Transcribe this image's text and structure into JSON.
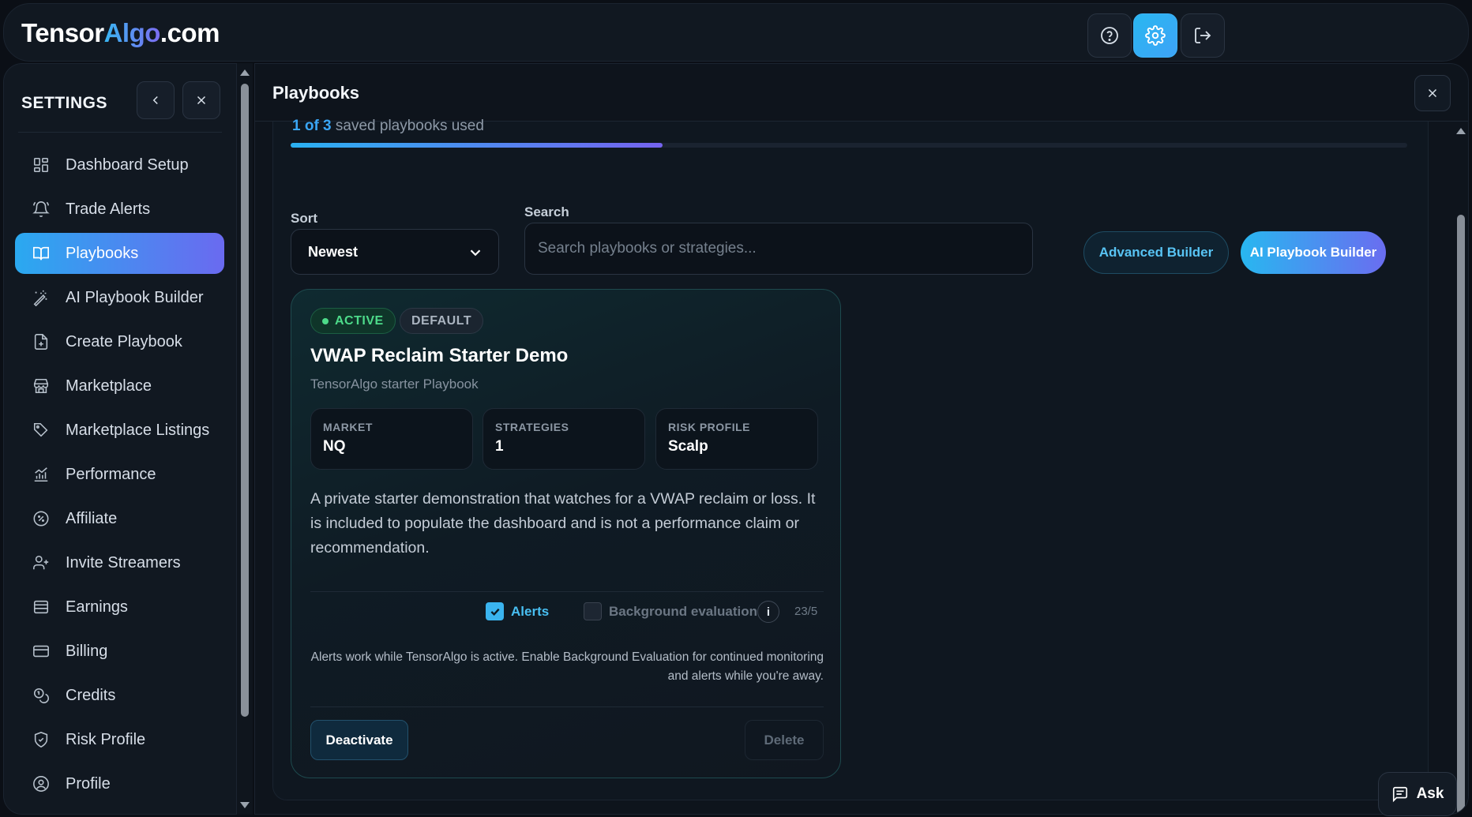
{
  "brand": {
    "prefix": "Tensor",
    "accent": "Algo",
    "suffix": ".com"
  },
  "topbar": {
    "help_icon": "help-circle-icon",
    "settings_icon": "gear-icon",
    "logout_icon": "logout-icon"
  },
  "sidebar": {
    "title": "SETTINGS",
    "items": [
      {
        "label": "Dashboard Setup",
        "icon": "dashboard-icon"
      },
      {
        "label": "Trade Alerts",
        "icon": "bell-icon"
      },
      {
        "label": "Playbooks",
        "icon": "book-icon",
        "active": true
      },
      {
        "label": "AI Playbook Builder",
        "icon": "magic-wand-icon"
      },
      {
        "label": "Create Playbook",
        "icon": "file-plus-icon"
      },
      {
        "label": "Marketplace",
        "icon": "store-icon"
      },
      {
        "label": "Marketplace Listings",
        "icon": "tags-icon"
      },
      {
        "label": "Performance",
        "icon": "chart-icon"
      },
      {
        "label": "Affiliate",
        "icon": "badge-percent-icon"
      },
      {
        "label": "Invite Streamers",
        "icon": "user-plus-icon"
      },
      {
        "label": "Earnings",
        "icon": "wallet-icon"
      },
      {
        "label": "Billing",
        "icon": "credit-card-icon"
      },
      {
        "label": "Credits",
        "icon": "coins-icon"
      },
      {
        "label": "Risk Profile",
        "icon": "shield-icon"
      },
      {
        "label": "Profile",
        "icon": "user-circle-icon"
      }
    ]
  },
  "main": {
    "title": "Playbooks",
    "usage": {
      "count_text": "1 of 3",
      "rest_text": " saved playbooks used",
      "fraction": 0.333
    },
    "sort": {
      "label": "Sort",
      "value": "Newest"
    },
    "search": {
      "label": "Search",
      "placeholder": "Search playbooks or strategies..."
    },
    "buttons": {
      "advanced": "Advanced Builder",
      "ai": "AI Playbook Builder"
    },
    "card": {
      "badge_active": "ACTIVE",
      "badge_default": "DEFAULT",
      "title": "VWAP Reclaim Starter Demo",
      "subtitle": "TensorAlgo starter Playbook",
      "stats": [
        {
          "key": "MARKET",
          "value": "NQ"
        },
        {
          "key": "STRATEGIES",
          "value": "1"
        },
        {
          "key": "RISK PROFILE",
          "value": "Scalp"
        }
      ],
      "description": "A private starter demonstration that watches for a VWAP reclaim or loss. It is included to populate the dashboard and is not a performance claim or recommendation.",
      "alerts_label": "Alerts",
      "background_label": "Background evaluation",
      "info_glyph": "i",
      "count": "23/5",
      "note": "Alerts work while TensorAlgo is active. Enable Background Evaluation for continued monitoring and alerts while you're away.",
      "deactivate": "Deactivate",
      "delete": "Delete"
    }
  },
  "ask": {
    "label": "Ask"
  },
  "colors": {
    "accent_blue": "#2ab1f1",
    "accent_purple": "#7563ef",
    "active_green": "#4ddb8a"
  }
}
